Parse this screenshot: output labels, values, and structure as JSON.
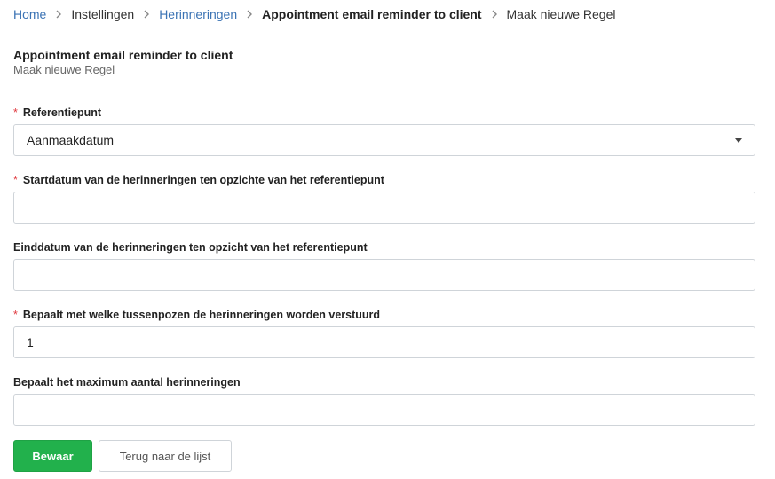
{
  "breadcrumb": {
    "items": [
      {
        "label": "Home",
        "link": true
      },
      {
        "label": "Instellingen",
        "link": false
      },
      {
        "label": "Herinneringen",
        "link": true
      },
      {
        "label": "Appointment email reminder to client",
        "link": false,
        "bold": true
      },
      {
        "label": "Maak nieuwe Regel",
        "link": false
      }
    ]
  },
  "page": {
    "title": "Appointment email reminder to client",
    "subtitle": "Maak nieuwe Regel"
  },
  "form": {
    "required_mark": "*",
    "reference": {
      "label": "Referentiepunt",
      "required": true,
      "value": "Aanmaakdatum"
    },
    "start": {
      "label": "Startdatum van de herinneringen ten opzichte van het referentiepunt",
      "required": true,
      "value": ""
    },
    "end": {
      "label": "Einddatum van de herinneringen ten opzicht van het referentiepunt",
      "required": false,
      "value": ""
    },
    "interval": {
      "label": "Bepaalt met welke tussenpozen de herinneringen worden verstuurd",
      "required": true,
      "value": "1"
    },
    "max": {
      "label": "Bepaalt het maximum aantal herinneringen",
      "required": false,
      "value": ""
    }
  },
  "buttons": {
    "save_label": "Bewaar",
    "back_label": "Terug naar de lijst"
  },
  "colors": {
    "link": "#3b73b4",
    "required": "#e0383e",
    "primary_button": "#22b14c"
  }
}
